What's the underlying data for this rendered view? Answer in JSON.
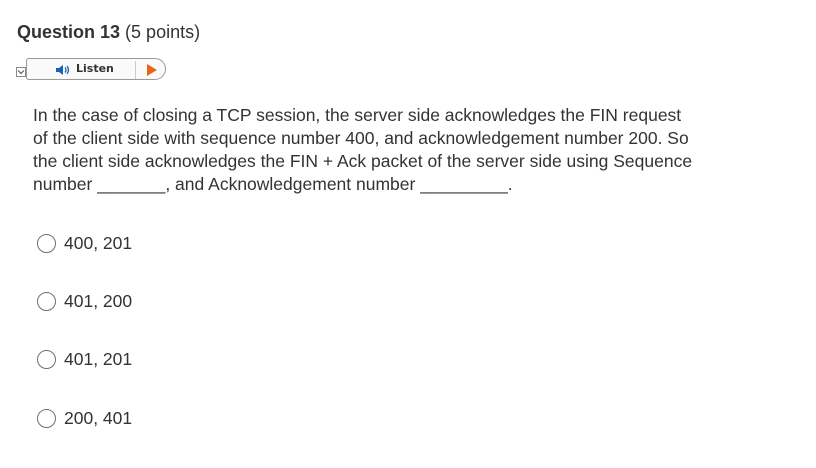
{
  "question": {
    "title": "Question 13",
    "points": "(5 points)",
    "lines": [
      " In the case of closing a TCP session, the server side acknowledges the FIN request",
      "of the client side with sequence number 400, and acknowledgement number 200. So",
      "the client side acknowledges the FIN + Ack packet of the server side using Sequence",
      "number _______, and Acknowledgement number _________."
    ]
  },
  "listen": {
    "label": "Listen",
    "icons": {
      "toggle": "chevron-down-icon",
      "speaker": "speaker-icon",
      "play": "play-icon"
    },
    "accent_color": "#e8641a",
    "speaker_color": "#1a5fb4"
  },
  "options": [
    {
      "label": "400, 201"
    },
    {
      "label": "401, 200"
    },
    {
      "label": "401, 201"
    },
    {
      "label": "200, 401"
    }
  ]
}
